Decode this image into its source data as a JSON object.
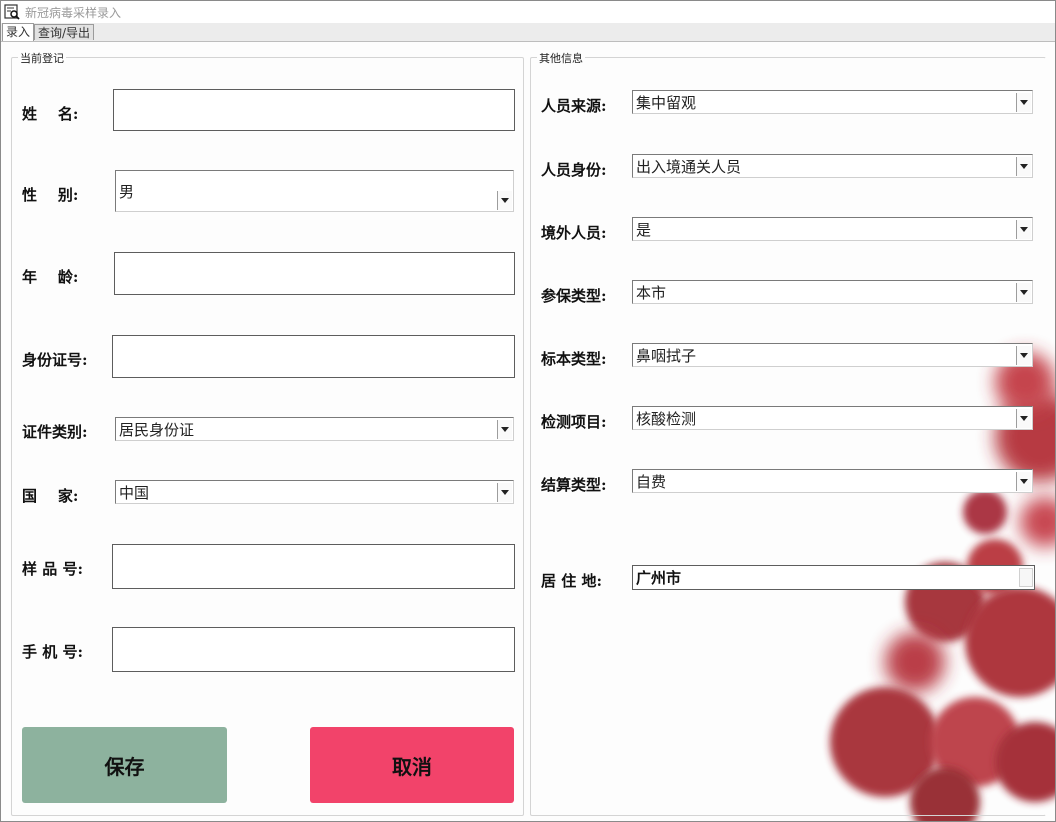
{
  "window": {
    "title": "新冠病毒采样录入"
  },
  "tabs": [
    {
      "label": "录入",
      "active": true
    },
    {
      "label": "查询/导出",
      "active": false
    }
  ],
  "current": {
    "legend": "当前登记",
    "name_label": "姓    名:",
    "name_value": "",
    "gender_label": "性    别:",
    "gender_value": "男",
    "age_label": "年    龄:",
    "age_value": "",
    "idno_label": "身份证号:",
    "idno_value": "",
    "idtype_label": "证件类别:",
    "idtype_value": "居民身份证",
    "country_label": "国    家:",
    "country_value": "中国",
    "sample_label": "样 品 号:",
    "sample_value": "",
    "phone_label": "手 机 号:",
    "phone_value": "",
    "save_label": "保存",
    "cancel_label": "取消"
  },
  "other": {
    "legend": "其他信息",
    "source_label": "人员来源:",
    "source_value": "集中留观",
    "identity_label": "人员身份:",
    "identity_value": "出入境通关人员",
    "foreign_label": "境外人员:",
    "foreign_value": "是",
    "insurance_label": "参保类型:",
    "insurance_value": "本市",
    "specimen_label": "标本类型:",
    "specimen_value": "鼻咽拭子",
    "test_label": "检测项目:",
    "test_value": "核酸检测",
    "settlement_label": "结算类型:",
    "settlement_value": "自费",
    "residence_label": "居 住 地:",
    "residence_value": "广州市"
  },
  "colors": {
    "save_button": "#8db29e",
    "cancel_button": "#f2436a",
    "virus_decoration": "#b0262f"
  }
}
